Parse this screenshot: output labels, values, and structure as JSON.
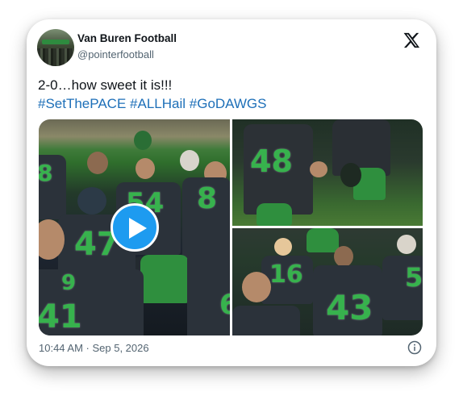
{
  "post": {
    "author_name": "Van Buren Football",
    "author_handle": "@pointerfootball",
    "text": "2-0…how sweet it is!!!",
    "hashtags": [
      "#SetThePACE",
      "#ALLHail",
      "#GoDAWGS"
    ],
    "timestamp": "10:44 AM · Sep 5, 2026"
  },
  "media": {
    "jersey_numbers": {
      "tile1": [
        "8",
        "54",
        "8",
        "47",
        "9",
        "41",
        "6"
      ],
      "tile2": [
        "48"
      ],
      "tile3": [
        "16",
        "43",
        "5"
      ]
    }
  },
  "icons": {
    "platform": "x-logo-icon",
    "play": "play-icon",
    "info": "info-icon"
  },
  "colors": {
    "hashtag": "#1d6fb8",
    "play_button": "#1d9bf0",
    "jersey_number": "#37b24d"
  }
}
